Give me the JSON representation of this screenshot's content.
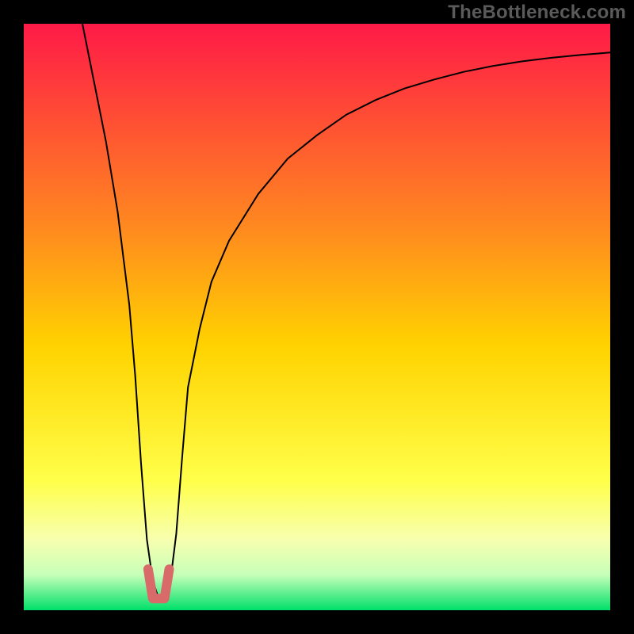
{
  "watermark": "TheBottleneck.com",
  "chart_data": {
    "type": "line",
    "title": "",
    "xlabel": "",
    "ylabel": "",
    "xlim": [
      0,
      100
    ],
    "ylim": [
      0,
      100
    ],
    "grid": false,
    "legend": false,
    "background_gradient": {
      "stops": [
        {
          "offset": 0.0,
          "color": "#ff1a47"
        },
        {
          "offset": 0.35,
          "color": "#ff8a1f"
        },
        {
          "offset": 0.55,
          "color": "#ffd300"
        },
        {
          "offset": 0.78,
          "color": "#ffff4a"
        },
        {
          "offset": 0.88,
          "color": "#f7ffb0"
        },
        {
          "offset": 0.94,
          "color": "#c6ffb8"
        },
        {
          "offset": 1.0,
          "color": "#00e06a"
        }
      ]
    },
    "series": [
      {
        "name": "bottleneck-curve",
        "stroke": "#000000",
        "stroke_width": 2,
        "x": [
          10,
          12,
          14,
          16,
          18,
          19,
          20,
          21,
          22,
          23,
          24,
          25,
          26,
          27,
          28,
          30,
          32,
          35,
          40,
          45,
          50,
          55,
          60,
          65,
          70,
          75,
          80,
          85,
          90,
          95,
          100
        ],
        "y": [
          100,
          90,
          80,
          68,
          52,
          40,
          25,
          12,
          5,
          2,
          2,
          5,
          13,
          26,
          38,
          48,
          56,
          63,
          71,
          77,
          81,
          84.5,
          87,
          89,
          90.5,
          91.8,
          92.8,
          93.6,
          94.2,
          94.7,
          95.1
        ]
      },
      {
        "name": "trough-highlight",
        "stroke": "#d86a6a",
        "stroke_width": 12,
        "linecap": "round",
        "x": [
          21.2,
          22,
          23,
          24,
          24.8
        ],
        "y": [
          7,
          2,
          2,
          2,
          7
        ]
      }
    ]
  }
}
